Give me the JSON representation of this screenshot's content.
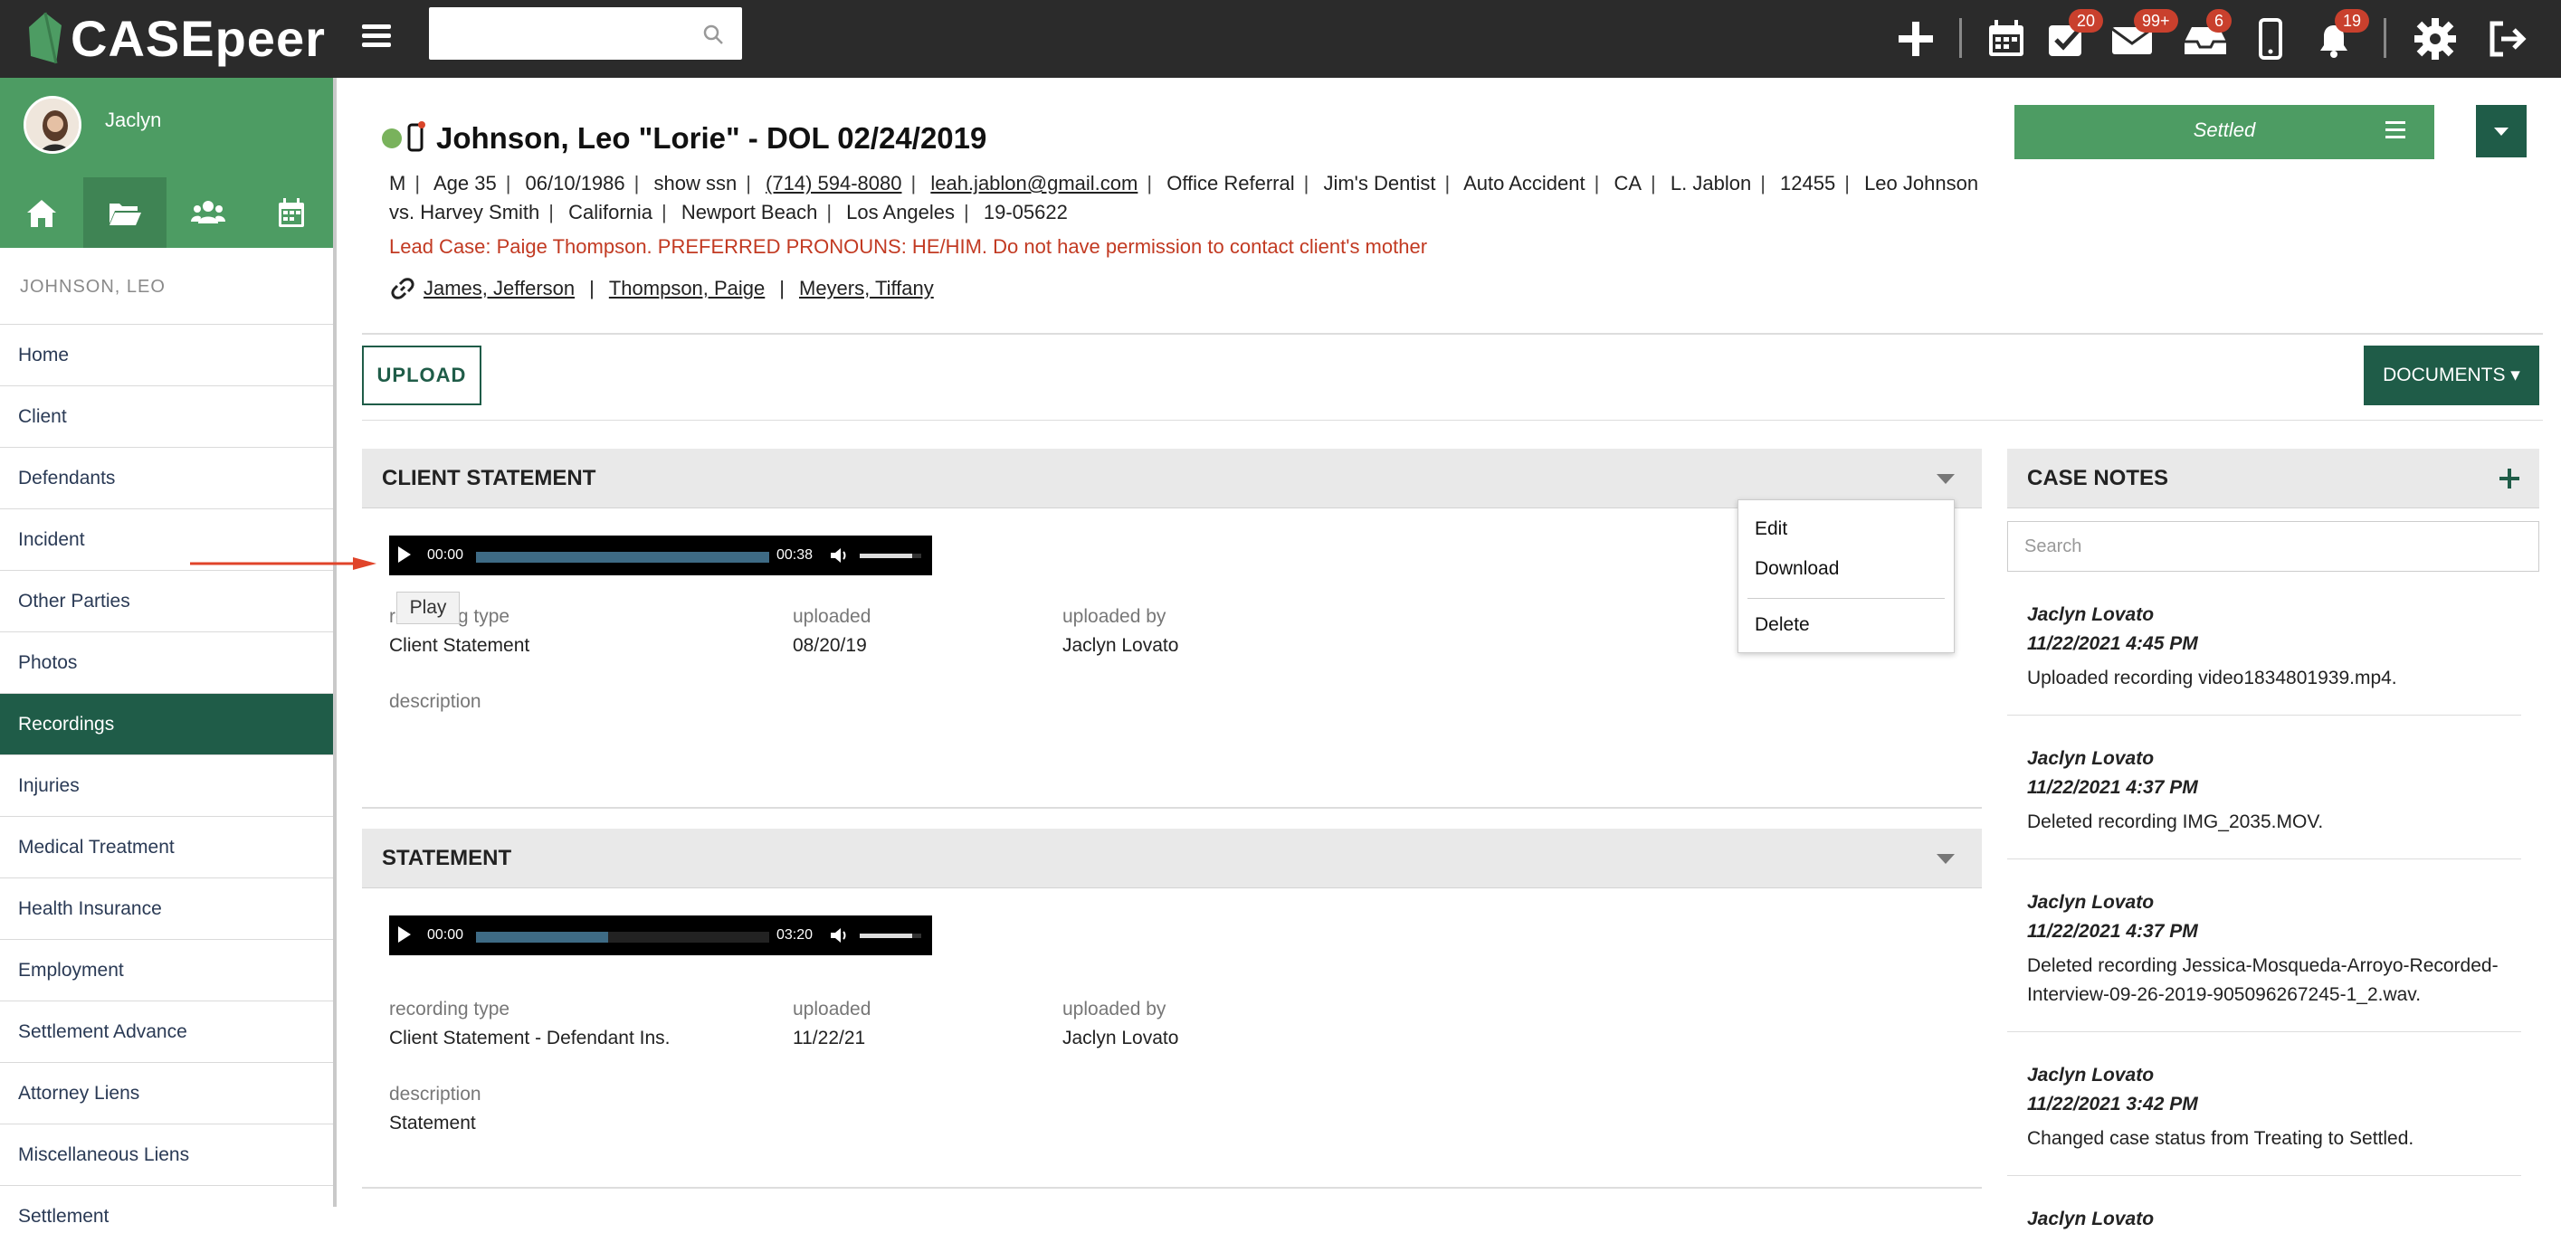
{
  "app": {
    "logo": "CASEpeer"
  },
  "topbar": {
    "search": {
      "placeholder": "",
      "value": ""
    },
    "badges": {
      "tasks": "20",
      "mail": "99+",
      "inbox": "6",
      "notifications": "19"
    }
  },
  "sidebar": {
    "user_name": "Jaclyn",
    "case_heading": "JOHNSON, LEO",
    "items": [
      {
        "label": "Home"
      },
      {
        "label": "Client"
      },
      {
        "label": "Defendants"
      },
      {
        "label": "Incident"
      },
      {
        "label": "Other Parties"
      },
      {
        "label": "Photos"
      },
      {
        "label": "Recordings",
        "active": true
      },
      {
        "label": "Injuries"
      },
      {
        "label": "Medical Treatment"
      },
      {
        "label": "Health Insurance"
      },
      {
        "label": "Employment"
      },
      {
        "label": "Settlement Advance"
      },
      {
        "label": "Attorney Liens"
      },
      {
        "label": "Miscellaneous Liens"
      },
      {
        "label": "Settlement"
      }
    ]
  },
  "case": {
    "title": "Johnson, Leo \"Lorie\" - DOL 02/24/2019",
    "status": "Settled",
    "info_line1": [
      "M",
      "Age 35",
      "06/10/1986",
      "show ssn",
      "(714) 594-8080",
      "leah.jablon@gmail.com",
      "Office Referral",
      "Jim's Dentist",
      "Auto Accident",
      "CA",
      "L. Jablon",
      "12455",
      "Leo Johnson"
    ],
    "info_line2": [
      "vs. Harvey Smith",
      "California",
      "Newport Beach",
      "Los Angeles",
      "19-05622"
    ],
    "alert": "Lead Case: Paige Thompson. PREFERRED PRONOUNS: HE/HIM. Do not have permission to contact client's mother",
    "linked": [
      "James, Jefferson",
      "Thompson, Paige",
      "Meyers, Tiffany"
    ]
  },
  "toolbar": {
    "upload": "UPLOAD",
    "documents": "DOCUMENTS ▾"
  },
  "recordings": [
    {
      "title": "CLIENT STATEMENT",
      "player": {
        "current": "00:00",
        "duration": "00:38",
        "progress": 1.0
      },
      "labels": {
        "type": "recording type",
        "uploaded": "uploaded",
        "by": "uploaded by",
        "description": "description"
      },
      "type": "Client Statement",
      "uploaded": "08/20/19",
      "uploaded_by": "Jaclyn Lovato",
      "description": ""
    },
    {
      "title": "STATEMENT",
      "player": {
        "current": "00:00",
        "duration": "03:20",
        "progress": 0.45
      },
      "labels": {
        "type": "recording type",
        "uploaded": "uploaded",
        "by": "uploaded by",
        "description": "description"
      },
      "type": "Client Statement - Defendant Ins.",
      "uploaded": "11/22/21",
      "uploaded_by": "Jaclyn Lovato",
      "description": "Statement"
    }
  ],
  "tooltip": "Play",
  "context_menu": [
    "Edit",
    "Download",
    "Delete"
  ],
  "notes": {
    "title": "CASE NOTES",
    "search_placeholder": "Search",
    "items": [
      {
        "who": "Jaclyn Lovato",
        "when": "11/22/2021 4:45 PM",
        "text": "Uploaded recording video1834801939.mp4."
      },
      {
        "who": "Jaclyn Lovato",
        "when": "11/22/2021 4:37 PM",
        "text": "Deleted recording IMG_2035.MOV."
      },
      {
        "who": "Jaclyn Lovato",
        "when": "11/22/2021 4:37 PM",
        "text": "Deleted recording Jessica-Mosqueda-Arroyo-Recorded-Interview-09-26-2019-905096267245-1_2.wav."
      },
      {
        "who": "Jaclyn Lovato",
        "when": "11/22/2021 3:42 PM",
        "text": "Changed case status from Treating to Settled."
      },
      {
        "who": "Jaclyn Lovato",
        "when": "",
        "text": ""
      }
    ]
  },
  "colors": {
    "brand_green": "#4d9c63",
    "dark_green": "#1f5c48",
    "alert_red": "#c23a22",
    "topbar": "#2b2b2b"
  }
}
